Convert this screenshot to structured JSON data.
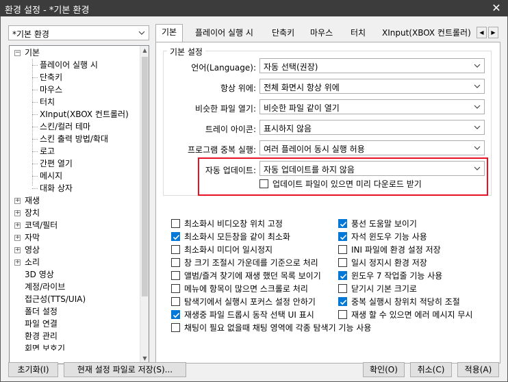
{
  "window": {
    "title": "환경 설정 - *기본 환경",
    "close_glyph": "✕"
  },
  "profile": {
    "selected": "*기본 환경"
  },
  "tree": {
    "root": "기본",
    "children": [
      "플레이어 실행 시",
      "단축키",
      "마우스",
      "터치",
      "XInput(XBOX 컨트롤러)",
      "스킨/컬러 테마",
      "스킨 출력 방법/확대",
      "로고",
      "간편 열기",
      "메시지",
      "대화 상자"
    ],
    "groups": [
      "재생",
      "장치",
      "코덱/필터",
      "자막",
      "영상",
      "소리"
    ],
    "leaves": [
      "3D 영상",
      "계정/라이브",
      "접근성(TTS/UIA)",
      "폴더 설정",
      "파일 연결",
      "환경 관리",
      "회면 보호기"
    ]
  },
  "tabs": [
    "기본",
    "플레이어 실행 시",
    "단축키",
    "마우스",
    "터치",
    "XInput(XBOX 컨트롤러)"
  ],
  "basic": {
    "group_title": "기본 설정",
    "rows": [
      {
        "label": "언어(Language):",
        "value": "자동 선택(권장)"
      },
      {
        "label": "항상 위에:",
        "value": "전체 화면시 항상 위에"
      },
      {
        "label": "비슷한 파일 열기:",
        "value": "비슷한 파일 같이 열기"
      },
      {
        "label": "트레이 아이콘:",
        "value": "표시하지 않음"
      },
      {
        "label": "프로그램 중복 실행:",
        "value": "여러 플레이어 동시 실행 허용"
      },
      {
        "label": "자동 업데이트:",
        "value": "자동 업데이트를 하지 않음"
      }
    ],
    "predownload": {
      "label": "업데이트 파일이 있으면 미리 다운로드 받기",
      "checked": false
    }
  },
  "options_left": [
    {
      "label": "최소화시 비디오창 위치 고정",
      "checked": false
    },
    {
      "label": "최소화시 모든창을 같이 최소화",
      "checked": true
    },
    {
      "label": "최소화시 미디어 일시정지",
      "checked": false
    },
    {
      "label": "창 크기 조절시 가운데를 기준으로 처리",
      "checked": false
    },
    {
      "label": "앨범/즐겨 찾기에 재생 했던 목록 보이기",
      "checked": false
    },
    {
      "label": "메뉴에 항목이 많으면 스크롤로 처리",
      "checked": false
    },
    {
      "label": "탐색기에서 실행시 포커스 설정 안하기",
      "checked": false
    },
    {
      "label": "재생중 파일 드롭시 동작 선택 UI 표시",
      "checked": true
    },
    {
      "label": "채팅이 필요 없을때 채팅 영역에 각종 탐색기 기능 사용",
      "checked": false
    }
  ],
  "options_right": [
    {
      "label": "풍선 도움말 보이기",
      "checked": true
    },
    {
      "label": "자석 윈도우 기능 사용",
      "checked": true
    },
    {
      "label": "INI 파일에 환경 설정 저장",
      "checked": false
    },
    {
      "label": "일시 정지시 환경 저장",
      "checked": false
    },
    {
      "label": "윈도우 7 작업줄 기능 사용",
      "checked": true
    },
    {
      "label": "닫기시 기본 크기로",
      "checked": false
    },
    {
      "label": "중복 실행시 창위치 적당히 조절",
      "checked": true
    },
    {
      "label": "재생 할 수 있으면 에러 메시지 무시",
      "checked": false
    }
  ],
  "footer": {
    "reset": "초기화(I)",
    "save_as": "현재 설정 파일로 저장(S)...",
    "ok": "확인(O)",
    "cancel": "취소(C)",
    "apply": "적용(A)"
  },
  "colors": {
    "accent": "#0078d7",
    "highlight_border": "#e81123",
    "titlebar": "#3c3c3c"
  }
}
